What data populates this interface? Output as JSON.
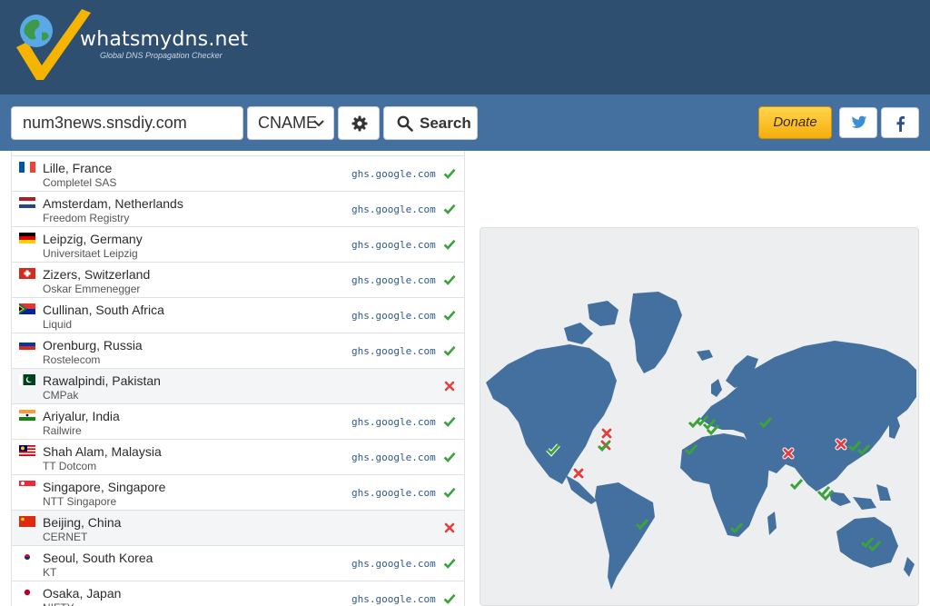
{
  "site": {
    "name": "whatsmydns.net",
    "tagline": "Global DNS Propagation Checker"
  },
  "search": {
    "domain_value": "num3news.snsdiy.com",
    "record_type": "CNAME",
    "search_label": "Search",
    "donate_label": "Donate"
  },
  "colors": {
    "header": "#2e4f70",
    "toolbar": "#44709f",
    "ok": "#3aa33a",
    "fail": "#e04040",
    "map_land": "#44709f"
  },
  "results": [
    {
      "location": "Lille, France",
      "provider": "Completel SAS",
      "answer": "ghs.google.com",
      "status": "ok",
      "flag": "fr"
    },
    {
      "location": "Amsterdam, Netherlands",
      "provider": "Freedom Registry",
      "answer": "ghs.google.com",
      "status": "ok",
      "flag": "nl"
    },
    {
      "location": "Leipzig, Germany",
      "provider": "Universitaet Leipzig",
      "answer": "ghs.google.com",
      "status": "ok",
      "flag": "de"
    },
    {
      "location": "Zizers, Switzerland",
      "provider": "Oskar Emmenegger",
      "answer": "ghs.google.com",
      "status": "ok",
      "flag": "ch"
    },
    {
      "location": "Cullinan, South Africa",
      "provider": "Liquid",
      "answer": "ghs.google.com",
      "status": "ok",
      "flag": "za"
    },
    {
      "location": "Orenburg, Russia",
      "provider": "Rostelecom",
      "answer": "ghs.google.com",
      "status": "ok",
      "flag": "ru"
    },
    {
      "location": "Rawalpindi, Pakistan",
      "provider": "CMPak",
      "answer": "",
      "status": "fail",
      "flag": "pk"
    },
    {
      "location": "Ariyalur, India",
      "provider": "Railwire",
      "answer": "ghs.google.com",
      "status": "ok",
      "flag": "in"
    },
    {
      "location": "Shah Alam, Malaysia",
      "provider": "TT Dotcom",
      "answer": "ghs.google.com",
      "status": "ok",
      "flag": "my"
    },
    {
      "location": "Singapore, Singapore",
      "provider": "NTT Singapore",
      "answer": "ghs.google.com",
      "status": "ok",
      "flag": "sg"
    },
    {
      "location": "Beijing, China",
      "provider": "CERNET",
      "answer": "",
      "status": "fail",
      "flag": "cn"
    },
    {
      "location": "Seoul, South Korea",
      "provider": "KT",
      "answer": "ghs.google.com",
      "status": "ok",
      "flag": "kr"
    },
    {
      "location": "Osaka, Japan",
      "provider": "NIFTY",
      "answer": "ghs.google.com",
      "status": "ok",
      "flag": "jp"
    }
  ],
  "map_markers": [
    {
      "label": "North America West",
      "status": "ok"
    },
    {
      "label": "North America East",
      "status": "fail"
    },
    {
      "label": "North America East 2",
      "status": "ok"
    },
    {
      "label": "Mexico",
      "status": "fail"
    },
    {
      "label": "Brazil",
      "status": "ok"
    },
    {
      "label": "West Africa",
      "status": "ok"
    },
    {
      "label": "Europe",
      "status": "ok"
    },
    {
      "label": "Russia",
      "status": "ok"
    },
    {
      "label": "Pakistan",
      "status": "fail"
    },
    {
      "label": "China",
      "status": "fail"
    },
    {
      "label": "Korea / Japan",
      "status": "ok"
    },
    {
      "label": "India",
      "status": "ok"
    },
    {
      "label": "Southeast Asia",
      "status": "ok"
    },
    {
      "label": "South Africa",
      "status": "ok"
    },
    {
      "label": "Australia",
      "status": "ok"
    }
  ]
}
